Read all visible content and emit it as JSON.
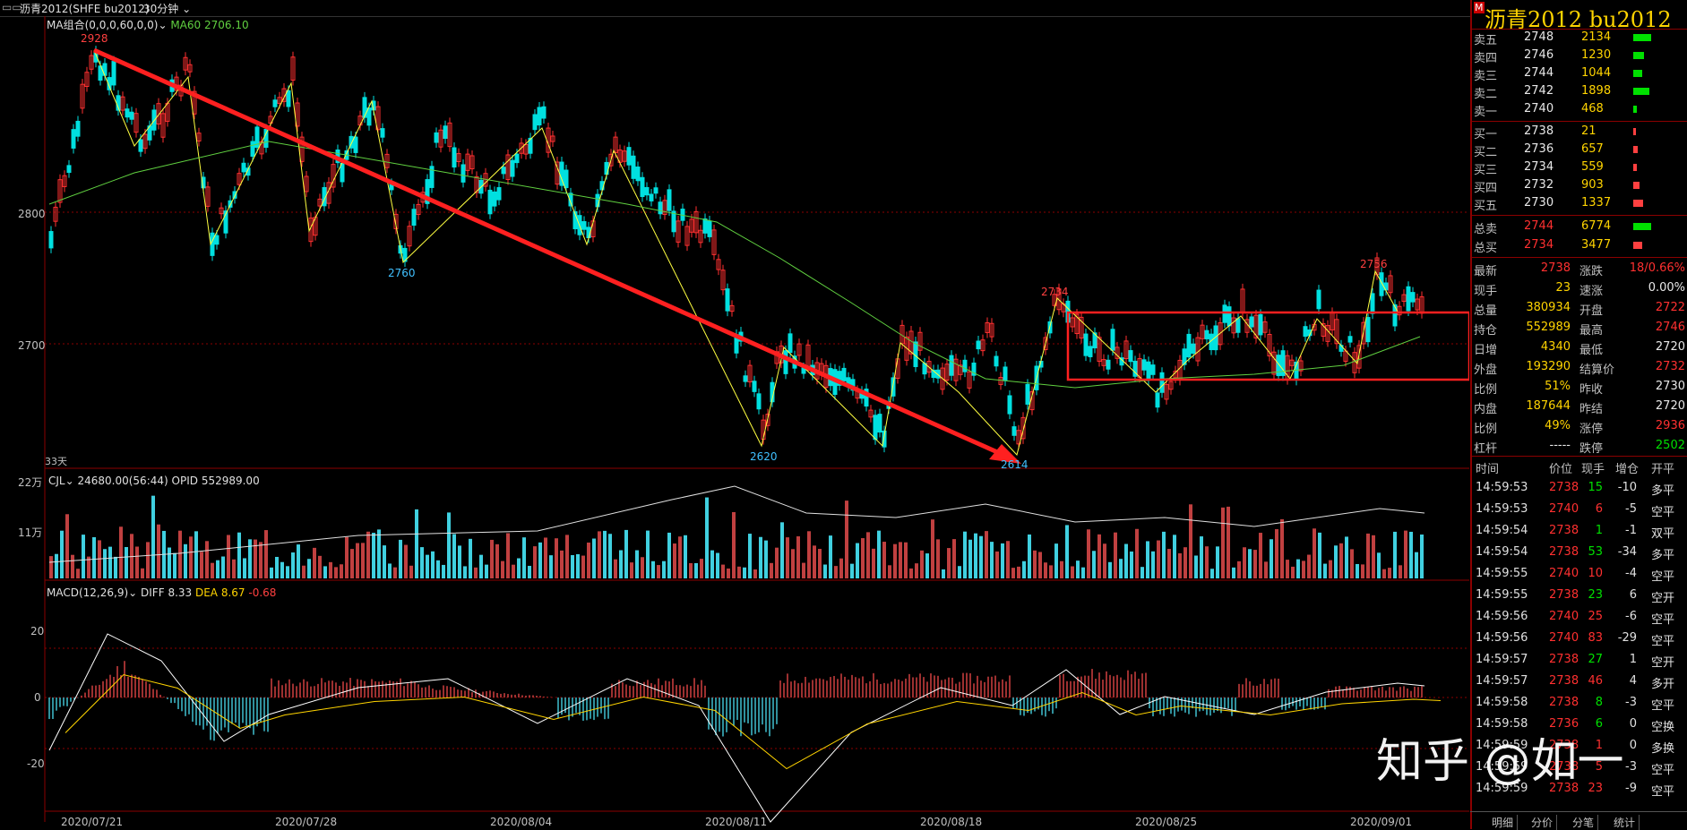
{
  "topbar": {
    "icon": "chart-icon",
    "title": "沥青2012(SHFE bu2012)",
    "period": "30分钟"
  },
  "main_chart": {
    "indicator_label": "MA组合(0,0,0,60,0,0)",
    "ma60_label": "MA60",
    "ma60_value": "2706.10",
    "y_ticks": [
      "2800",
      "2700"
    ],
    "days_label": "33天",
    "annotations": [
      {
        "text": "2928",
        "color": "#ff4040"
      },
      {
        "text": "2760",
        "color": "#40c0ff"
      },
      {
        "text": "2620",
        "color": "#40c0ff"
      },
      {
        "text": "2614",
        "color": "#40c0ff"
      },
      {
        "text": "2734",
        "color": "#ff4040"
      },
      {
        "text": "2756",
        "color": "#ff4040"
      }
    ]
  },
  "volume_chart": {
    "label": "CJL",
    "value": "24680.00(56:44)",
    "opid_label": "OPID",
    "opid_value": "552989.00",
    "y_ticks": [
      "22万",
      "11万"
    ]
  },
  "macd_chart": {
    "label": "MACD(12,26,9)",
    "diff_label": "DIFF",
    "diff_value": "8.33",
    "dea_label": "DEA",
    "dea_value": "8.67",
    "macd_value": "-0.68",
    "y_ticks": [
      "20",
      "0",
      "-20"
    ]
  },
  "x_axis": [
    "2020/07/21",
    "2020/07/28",
    "2020/08/04",
    "2020/08/11",
    "2020/08/18",
    "2020/08/25",
    "2020/09/01"
  ],
  "colors": {
    "up": "#ff3030",
    "down": "#00e0e0",
    "trend_arrow": "#ff2020",
    "ma60": "#60d040",
    "zigzag": "#ffff40"
  },
  "panel": {
    "mark": "M",
    "title": "沥青2012  bu2012",
    "asks": [
      {
        "label": "卖五",
        "price": "2748",
        "vol": "2134",
        "level": 0.75
      },
      {
        "label": "卖四",
        "price": "2746",
        "vol": "1230",
        "level": 0.45
      },
      {
        "label": "卖三",
        "price": "2744",
        "vol": "1044",
        "level": 0.38
      },
      {
        "label": "卖二",
        "price": "2742",
        "vol": "1898",
        "level": 0.68
      },
      {
        "label": "卖一",
        "price": "2740",
        "vol": "468",
        "level": 0.17
      }
    ],
    "bids": [
      {
        "label": "买一",
        "price": "2738",
        "vol": "21",
        "level": 0.02
      },
      {
        "label": "买二",
        "price": "2736",
        "vol": "657",
        "level": 0.2
      },
      {
        "label": "买三",
        "price": "2734",
        "vol": "559",
        "level": 0.17
      },
      {
        "label": "买四",
        "price": "2732",
        "vol": "903",
        "level": 0.28
      },
      {
        "label": "买五",
        "price": "2730",
        "vol": "1337",
        "level": 0.42
      }
    ],
    "totals": [
      {
        "label": "总卖",
        "price": "2744",
        "vol": "6774",
        "color": "green",
        "level": 0.75
      },
      {
        "label": "总买",
        "price": "2734",
        "vol": "3477",
        "color": "red",
        "level": 0.4
      }
    ],
    "stats": [
      {
        "l1": "最新",
        "v1": "2738",
        "c1": "red",
        "l2": "涨跌",
        "v2": "18/0.66%",
        "c2": "red"
      },
      {
        "l1": "现手",
        "v1": "23",
        "c1": "yellow",
        "l2": "速涨",
        "v2": "0.00%",
        "c2": "white"
      },
      {
        "l1": "总量",
        "v1": "380934",
        "c1": "yellow",
        "l2": "开盘",
        "v2": "2722",
        "c2": "red"
      },
      {
        "l1": "持仓",
        "v1": "552989",
        "c1": "yellow",
        "l2": "最高",
        "v2": "2746",
        "c2": "red"
      },
      {
        "l1": "日增",
        "v1": "4340",
        "c1": "yellow",
        "l2": "最低",
        "v2": "2720",
        "c2": "white"
      },
      {
        "l1": "外盘",
        "v1": "193290",
        "c1": "yellow",
        "l2": "结算价",
        "v2": "2732",
        "c2": "red"
      },
      {
        "l1": "比例",
        "v1": "51%",
        "c1": "yellow",
        "l2": "昨收",
        "v2": "2730",
        "c2": "white"
      },
      {
        "l1": "内盘",
        "v1": "187644",
        "c1": "yellow",
        "l2": "昨结",
        "v2": "2720",
        "c2": "white"
      },
      {
        "l1": "比例",
        "v1": "49%",
        "c1": "yellow",
        "l2": "涨停",
        "v2": "2936",
        "c2": "red"
      },
      {
        "l1": "杠杆",
        "v1": "-----",
        "c1": "white",
        "l2": "跌停",
        "v2": "2502",
        "c2": "green"
      }
    ],
    "tick_headers": [
      "时间",
      "价位",
      "现手",
      "增仓",
      "开平"
    ],
    "ticks": [
      {
        "t": "14:59:53",
        "p": "2738",
        "v": "15",
        "d": "-10",
        "k": "多平",
        "pc": "red",
        "vc": "green"
      },
      {
        "t": "14:59:53",
        "p": "2740",
        "v": "6",
        "d": "-5",
        "k": "空平",
        "pc": "red",
        "vc": "red"
      },
      {
        "t": "14:59:54",
        "p": "2738",
        "v": "1",
        "d": "-1",
        "k": "双平",
        "pc": "red",
        "vc": "green"
      },
      {
        "t": "14:59:54",
        "p": "2738",
        "v": "53",
        "d": "-34",
        "k": "多平",
        "pc": "red",
        "vc": "green"
      },
      {
        "t": "14:59:55",
        "p": "2740",
        "v": "10",
        "d": "-4",
        "k": "空平",
        "pc": "red",
        "vc": "red"
      },
      {
        "t": "14:59:55",
        "p": "2738",
        "v": "23",
        "d": "6",
        "k": "空开",
        "pc": "red",
        "vc": "green"
      },
      {
        "t": "14:59:56",
        "p": "2740",
        "v": "25",
        "d": "-6",
        "k": "空平",
        "pc": "red",
        "vc": "red"
      },
      {
        "t": "14:59:56",
        "p": "2740",
        "v": "83",
        "d": "-29",
        "k": "空平",
        "pc": "red",
        "vc": "red"
      },
      {
        "t": "14:59:57",
        "p": "2738",
        "v": "27",
        "d": "1",
        "k": "空开",
        "pc": "red",
        "vc": "green"
      },
      {
        "t": "14:59:57",
        "p": "2738",
        "v": "46",
        "d": "4",
        "k": "多开",
        "pc": "red",
        "vc": "red"
      },
      {
        "t": "14:59:58",
        "p": "2738",
        "v": "8",
        "d": "-3",
        "k": "空平",
        "pc": "red",
        "vc": "green"
      },
      {
        "t": "14:59:58",
        "p": "2736",
        "v": "6",
        "d": "0",
        "k": "空换",
        "pc": "red",
        "vc": "green"
      },
      {
        "t": "14:59:59",
        "p": "2738",
        "v": "1",
        "d": "0",
        "k": "多换",
        "pc": "red",
        "vc": "red"
      },
      {
        "t": "14:59:59",
        "p": "2738",
        "v": "5",
        "d": "-3",
        "k": "空平",
        "pc": "red",
        "vc": "red"
      },
      {
        "t": "14:59:59",
        "p": "2738",
        "v": "23",
        "d": "-9",
        "k": "空平",
        "pc": "red",
        "vc": "red"
      }
    ],
    "tabs": [
      "明细",
      "分价",
      "分笔",
      "统计"
    ]
  },
  "watermark": "知乎 @如一"
}
